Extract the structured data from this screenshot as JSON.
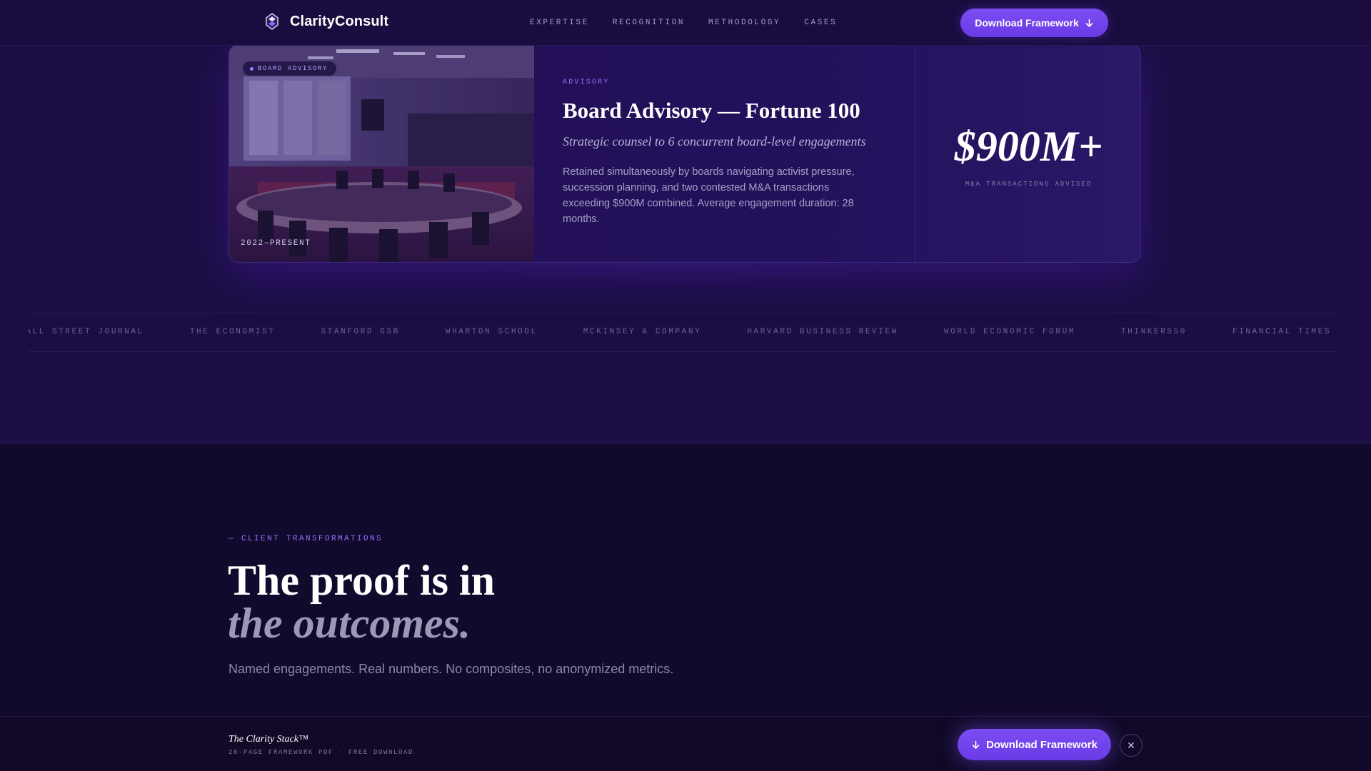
{
  "header": {
    "brand": "ClarityConsult",
    "nav": [
      "EXPERTISE",
      "RECOGNITION",
      "METHODOLOGY",
      "CASES"
    ],
    "cta_label": "Download Framework"
  },
  "case": {
    "badge": "BOARD ADVISORY",
    "period": "2022–PRESENT",
    "eyebrow": "ADVISORY",
    "title": "Board Advisory — Fortune 100",
    "subtitle": "Strategic counsel to 6 concurrent board-level engagements",
    "description": "Retained simultaneously by boards navigating activist pressure, succession planning, and two contested M&A transactions exceeding $900M combined. Average engagement duration: 28 months.",
    "stat_value": "$900M+",
    "stat_label": "M&A TRANSACTIONS ADVISED"
  },
  "press": [
    "WALL STREET JOURNAL",
    "THE ECONOMIST",
    "STANFORD GSB",
    "WHARTON SCHOOL",
    "MCKINSEY & COMPANY",
    "HARVARD BUSINESS REVIEW",
    "WORLD ECONOMIC FORUM",
    "THINKERS50",
    "FINANCIAL TIMES"
  ],
  "transformations": {
    "eyebrow": "— CLIENT TRANSFORMATIONS",
    "headline_line1": "The proof is in",
    "headline_line2": "the outcomes.",
    "description": "Named engagements. Real numbers. No composites, no anonymized metrics."
  },
  "sticky": {
    "title": "The Clarity Stack™",
    "subtitle": "28-PAGE FRAMEWORK PDF · FREE DOWNLOAD",
    "cta_label": "Download Framework",
    "close_glyph": "✕"
  },
  "icons": {
    "brand": "gem-logo-icon",
    "download": "arrow-down-icon",
    "close": "close-icon"
  },
  "colors": {
    "accent": "#6f42ea",
    "page_bg": "#1c0e44",
    "lower_bg": "#120a2c"
  }
}
